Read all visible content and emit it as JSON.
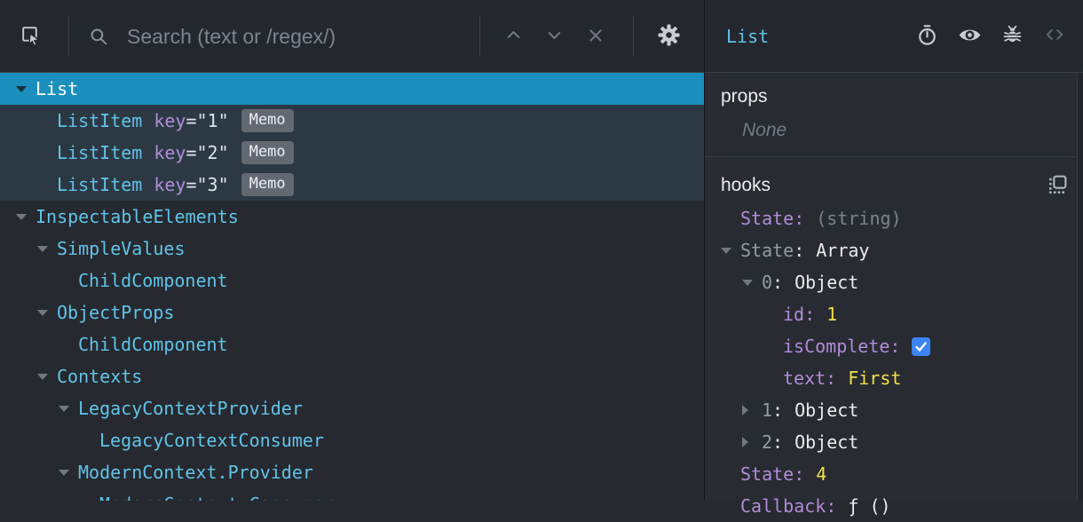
{
  "toolbar": {
    "search_placeholder": "Search (text or /regex/)"
  },
  "tree": {
    "rows": [
      {
        "label": "List",
        "depth": 0,
        "expander": true,
        "selected": true
      },
      {
        "label": "ListItem",
        "depth": 1,
        "key": "1",
        "badge": "Memo",
        "tinted": true
      },
      {
        "label": "ListItem",
        "depth": 1,
        "key": "2",
        "badge": "Memo",
        "tinted": true
      },
      {
        "label": "ListItem",
        "depth": 1,
        "key": "3",
        "badge": "Memo",
        "tinted": true
      },
      {
        "label": "InspectableElements",
        "depth": 0,
        "expander": true
      },
      {
        "label": "SimpleValues",
        "depth": 1,
        "expander": true
      },
      {
        "label": "ChildComponent",
        "depth": 2
      },
      {
        "label": "ObjectProps",
        "depth": 1,
        "expander": true
      },
      {
        "label": "ChildComponent",
        "depth": 2
      },
      {
        "label": "Contexts",
        "depth": 1,
        "expander": true
      },
      {
        "label": "LegacyContextProvider",
        "depth": 2,
        "expander": true
      },
      {
        "label": "LegacyContextConsumer",
        "depth": 3
      },
      {
        "label": "ModernContext.Provider",
        "depth": 2,
        "expander": true
      },
      {
        "label": "ModernContext.Consumer",
        "depth": 3
      }
    ]
  },
  "inspector": {
    "title": "List",
    "props": {
      "label": "props",
      "empty_text": "None"
    },
    "hooks": {
      "label": "hooks",
      "rows": [
        {
          "name": "State",
          "value": "(string)",
          "name_style": "purple",
          "value_style": "muted",
          "depth": 0
        },
        {
          "name": "State",
          "value": "Array",
          "name_style": "gray",
          "value_style": "white",
          "depth": 0,
          "arrow": "expanded"
        },
        {
          "name": "0",
          "value": "Object",
          "name_style": "gray",
          "value_style": "white",
          "depth": 1,
          "arrow": "expanded"
        },
        {
          "name": "id",
          "value": "1",
          "name_style": "purple",
          "value_style": "yellow",
          "depth": 2
        },
        {
          "name": "isComplete",
          "value": "checked",
          "name_style": "purple",
          "value_style": "checkbox",
          "depth": 2
        },
        {
          "name": "text",
          "value": "First",
          "name_style": "purple",
          "value_style": "yellow",
          "depth": 2
        },
        {
          "name": "1",
          "value": "Object",
          "name_style": "gray",
          "value_style": "white",
          "depth": 1,
          "arrow": "collapsed"
        },
        {
          "name": "2",
          "value": "Object",
          "name_style": "gray",
          "value_style": "white",
          "depth": 1,
          "arrow": "collapsed"
        },
        {
          "name": "State",
          "value": "4",
          "name_style": "purple",
          "value_style": "yellow",
          "depth": 0
        },
        {
          "name": "Callback",
          "value": "ƒ ()",
          "name_style": "purple",
          "value_style": "white",
          "depth": 0
        }
      ]
    }
  },
  "colors": {
    "selected_row": "#1a8fbe",
    "component_name": "#61c3e8",
    "attribute_purple": "#b18cda",
    "value_yellow": "#f2e049",
    "checkbox_blue": "#3d84f7",
    "memo_badge_bg": "#636973"
  }
}
